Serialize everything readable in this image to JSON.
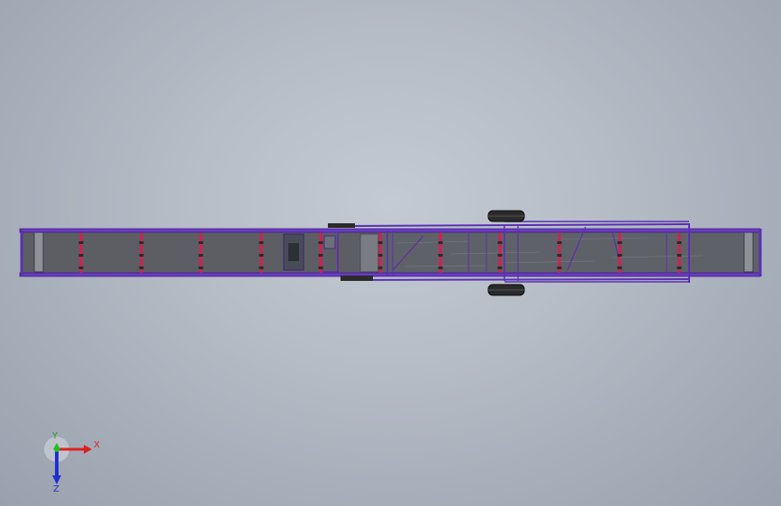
{
  "viewport": {
    "background_top": "#c3cad3",
    "background_bottom": "#98a1ad"
  },
  "model": {
    "frame_color": "#5b2fb0",
    "roller_color": "#d4204e",
    "belt_color": "#5a5c62",
    "wheel_color": "#2b2b2b",
    "roller_count_left": 5,
    "roller_count_right": 6
  },
  "triad": {
    "x_label": "X",
    "y_label": "Y",
    "z_label": "Z",
    "x_color": "#e02020",
    "y_color": "#20c020",
    "z_color": "#2030d0"
  }
}
